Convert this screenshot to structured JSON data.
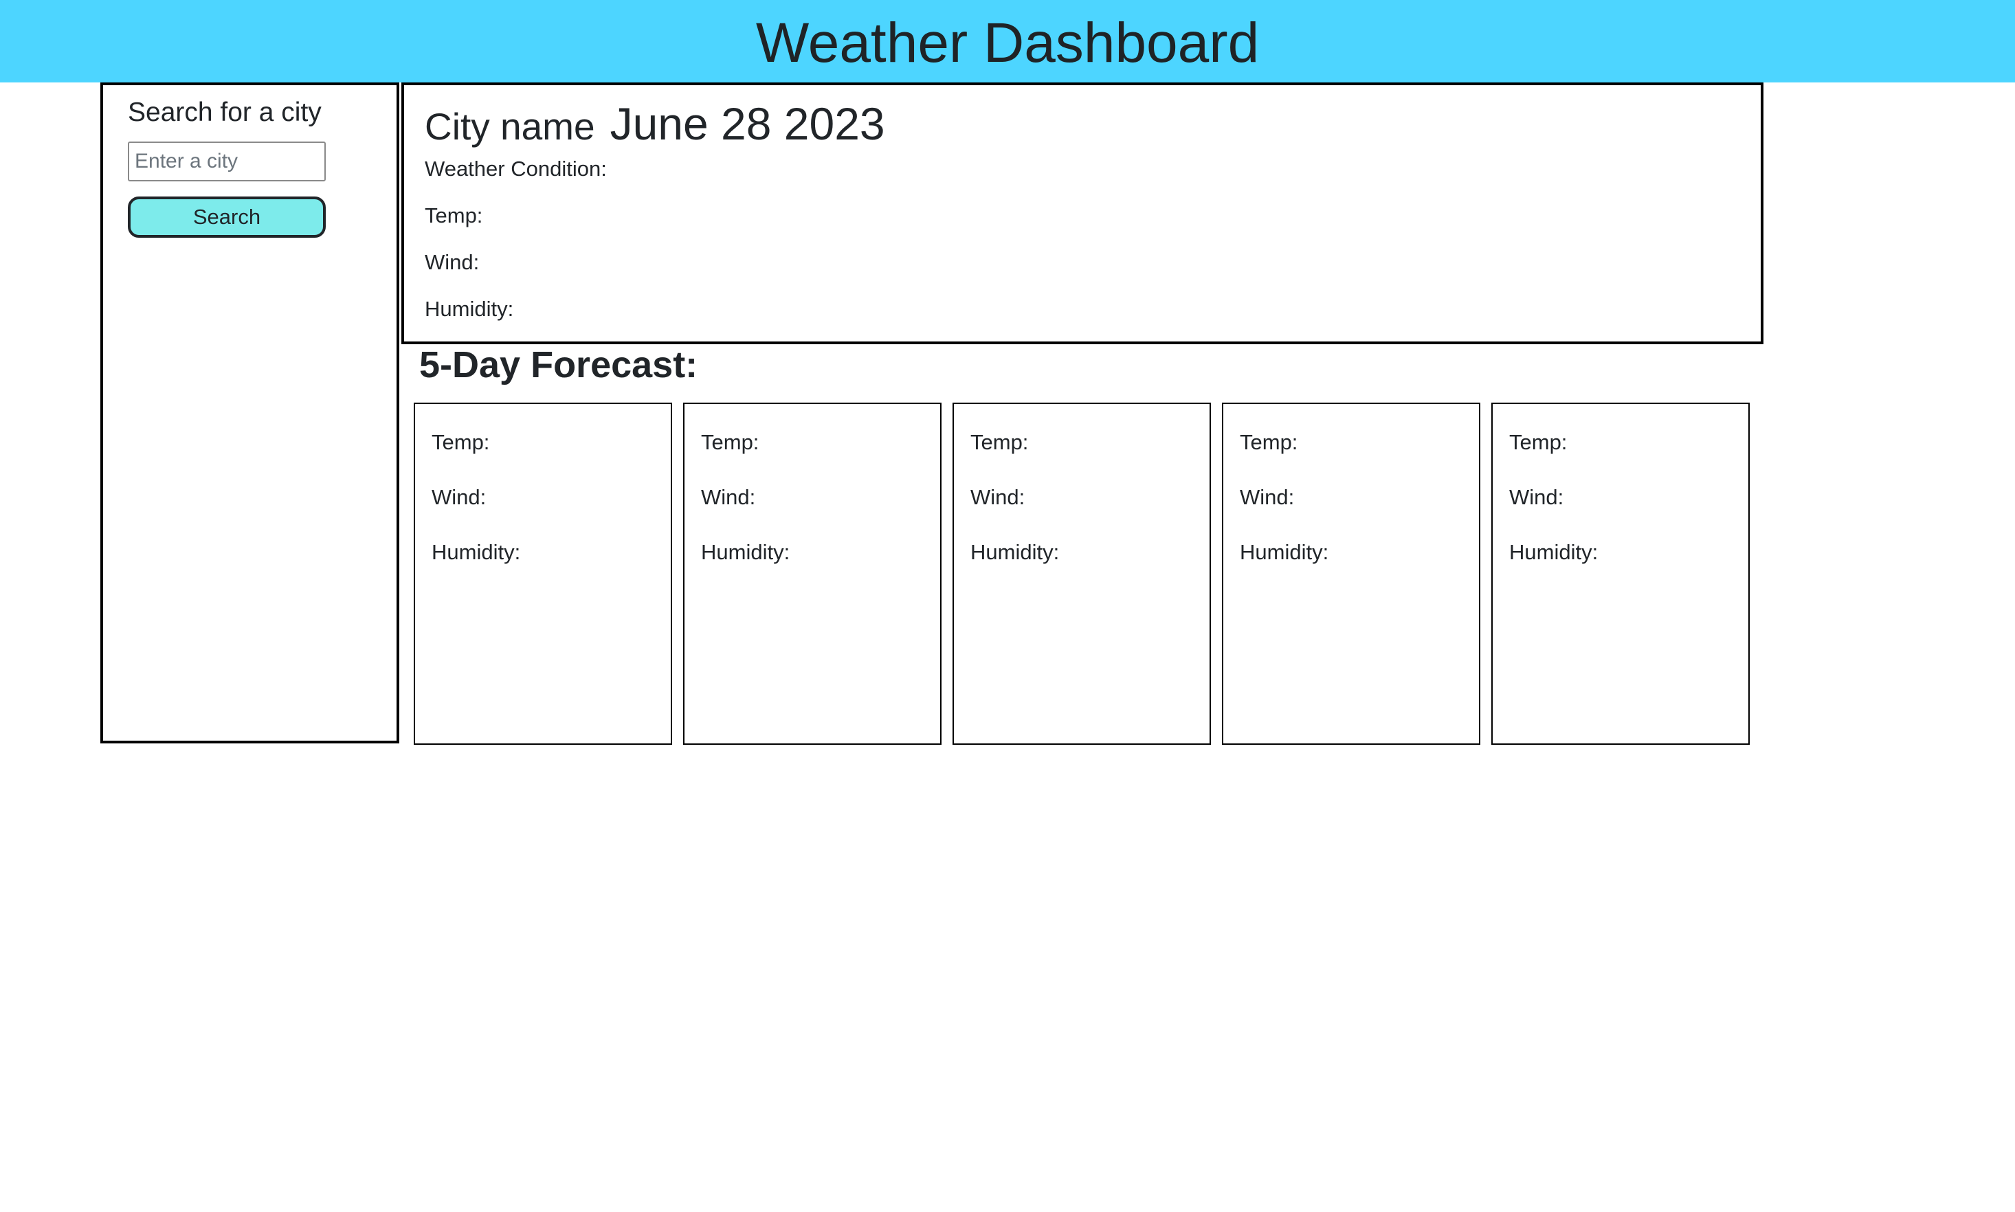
{
  "header": {
    "title": "Weather Dashboard",
    "background": "#4dd5ff"
  },
  "sidebar": {
    "title": "Search for a city",
    "input": {
      "value": "",
      "placeholder": "Enter a city"
    },
    "search_button": {
      "label": "Search",
      "background": "#7debeb"
    }
  },
  "current": {
    "city": "City name",
    "date": "June 28 2023",
    "fields": [
      "Weather Condition:",
      "Temp:",
      "Wind:",
      "Humidity:"
    ]
  },
  "forecast": {
    "title": "5-Day Forecast:",
    "cards": [
      {
        "temp": "Temp:",
        "wind": "Wind:",
        "humidity": "Humidity:"
      },
      {
        "temp": "Temp:",
        "wind": "Wind:",
        "humidity": "Humidity:"
      },
      {
        "temp": "Temp:",
        "wind": "Wind:",
        "humidity": "Humidity:"
      },
      {
        "temp": "Temp:",
        "wind": "Wind:",
        "humidity": "Humidity:"
      },
      {
        "temp": "Temp:",
        "wind": "Wind:",
        "humidity": "Humidity:"
      }
    ]
  }
}
